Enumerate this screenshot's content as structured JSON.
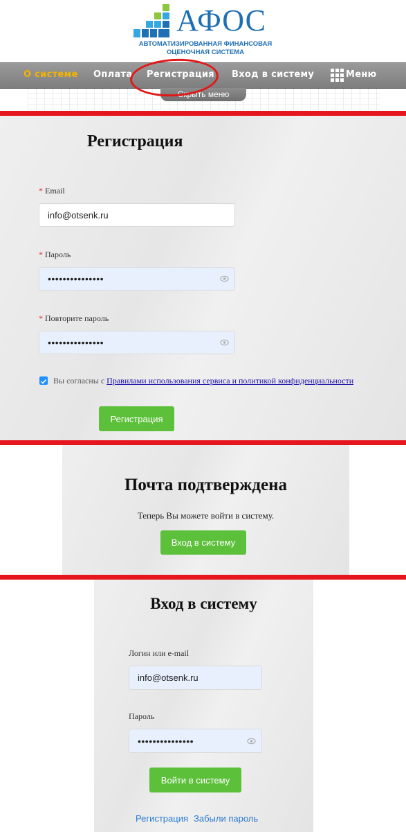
{
  "brand": {
    "name": "АФОС",
    "subtitle_line1": "АВТОМАТИЗИРОВАННАЯ ФИНАНСОВАЯ",
    "subtitle_line2": "ОЦЕНОЧНАЯ СИСТЕМА",
    "colors": {
      "blue": "#1f6fb4",
      "light_blue": "#35a8e0",
      "green": "#8cc63f"
    }
  },
  "nav": {
    "items": [
      {
        "label": "О системе",
        "active": true
      },
      {
        "label": "Оплата"
      },
      {
        "label": "Регистрация"
      },
      {
        "label": "Вход в систему"
      }
    ],
    "menu_label": "Меню",
    "menu_icon": "grid-icon",
    "hide_menu_label": "Скрыть меню",
    "active_color": "#f2b400"
  },
  "registration": {
    "title": "Регистрация",
    "email_label": "Email",
    "email_value": "info@otsenk.ru",
    "password_label": "Пароль",
    "password_value": "•••••••••••••••",
    "repeat_label": "Повторите пароль",
    "repeat_value": "•••••••••••••••",
    "agree_prefix": "Вы согласны с ",
    "agree_link": "Правилами использования сервиса и политикой конфиденциальности",
    "submit_label": "Регистрация"
  },
  "confirmed": {
    "title": "Почта подтверждена",
    "message": "Теперь Вы можете войти в систему.",
    "button_label": "Вход в систему"
  },
  "login": {
    "title": "Вход в систему",
    "login_label": "Логин или e-mail",
    "login_value": "info@otsenk.ru",
    "password_label": "Пароль",
    "password_value": "•••••••••••••••",
    "submit_label": "Войти в систему",
    "register_link": "Регистрация",
    "forgot_link": "Забыли пароль"
  },
  "accent_colors": {
    "button_green": "#5cc03a",
    "annotation_red": "#e5161d",
    "link_blue": "#1a0dab"
  }
}
